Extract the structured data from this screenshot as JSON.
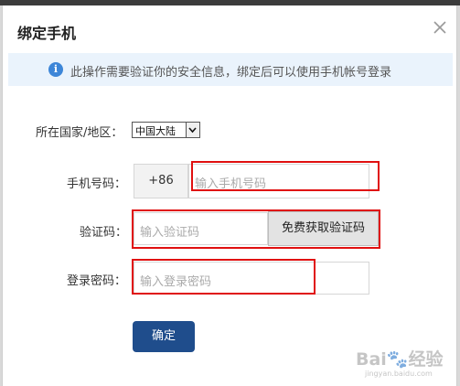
{
  "dialog": {
    "title": "绑定手机",
    "close_icon": "close-icon",
    "notice": {
      "icon": "info-icon",
      "text": "此操作需要验证你的安全信息，绑定后可以使用手机帐号登录"
    }
  },
  "form": {
    "region": {
      "label": "所在国家/地区：",
      "selected": "中国大陆",
      "arrow_icon": "chevron-down-icon"
    },
    "phone": {
      "label": "手机号码：",
      "prefix": "+86",
      "placeholder": "输入手机号码"
    },
    "code": {
      "label": "验证码：",
      "placeholder": "输入验证码",
      "button": "免费获取验证码"
    },
    "password": {
      "label": "登录密码：",
      "placeholder": "输入登录密码"
    },
    "submit": "确定"
  },
  "watermark": {
    "text": "Bai🐾经验",
    "sub": "jingyan.baidu.com"
  },
  "colors": {
    "highlight": "#e01010",
    "primary": "#1f4d8c",
    "info": "#3d86d8",
    "notice_bg": "#eaf3fc"
  }
}
